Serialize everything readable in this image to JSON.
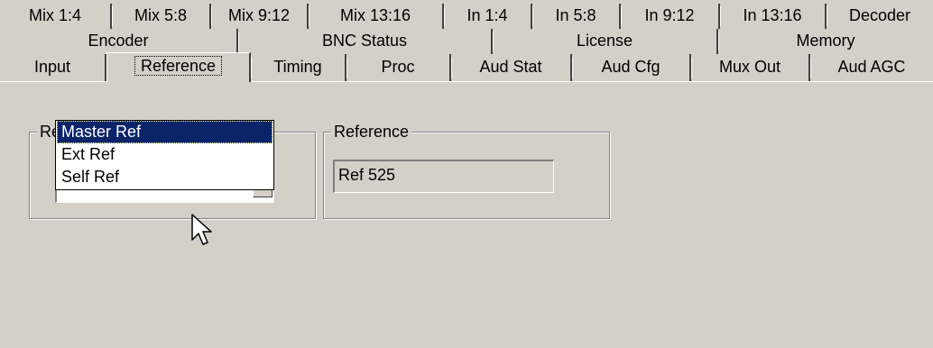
{
  "tabs": {
    "row1": [
      "Mix 1:4",
      "Mix 5:8",
      "Mix 9:12",
      "Mix 13:16",
      "In 1:4",
      "In 5:8",
      "In 9:12",
      "In 13:16",
      "Decoder"
    ],
    "row2": [
      "Encoder",
      "BNC Status",
      "License",
      "Memory"
    ],
    "row3": [
      "Input",
      "Reference",
      "Timing",
      "Proc",
      "Aud Stat",
      "Aud Cfg",
      "Mux Out",
      "Aud AGC"
    ],
    "selected": "Reference"
  },
  "ref_source": {
    "title": "Ref Source",
    "selected_value": "Master Ref",
    "options": [
      "Master Ref",
      "Ext Ref",
      "Self Ref"
    ]
  },
  "reference": {
    "title": "Reference",
    "value": "Ref 525"
  },
  "icons": {
    "dropdown_arrow": "chevron-down-icon",
    "cursor": "mouse-pointer-icon"
  },
  "colors": {
    "background": "#d4d0c8",
    "selection": "#0a246a"
  }
}
